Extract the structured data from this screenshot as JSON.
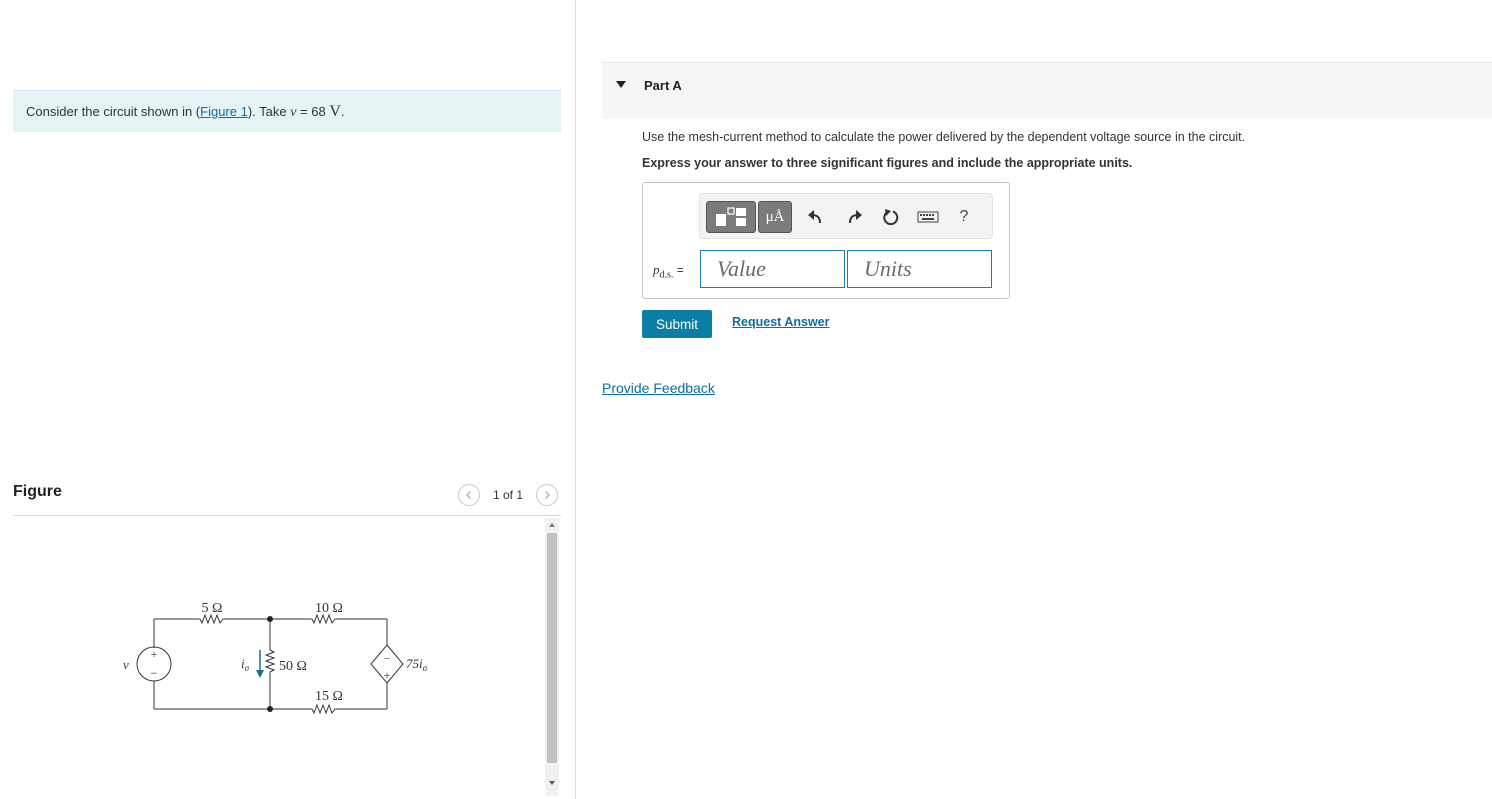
{
  "problem": {
    "prefix": "Consider the circuit shown in (",
    "figure_link": "Figure 1",
    "middle": "). Take ",
    "var": "v",
    "equals": " = 68 ",
    "unit": "V",
    "suffix": "."
  },
  "figure": {
    "title": "Figure",
    "pager": "1 of 1",
    "circuit": {
      "r1": "5 Ω",
      "r2": "10 Ω",
      "r3": "50 Ω",
      "r4": "15 Ω",
      "source_v": "v",
      "current_label": "i",
      "current_sub": "σ",
      "dep_source": "75i",
      "dep_source_sub": "σ",
      "plus": "+",
      "minus": "−"
    }
  },
  "part": {
    "title": "Part A",
    "question": "Use the mesh-current method to calculate the power delivered by the dependent voltage source in the circuit.",
    "instruction": "Express your answer to three significant figures and include the appropriate units.",
    "var_main": "p",
    "var_sub": "d.s.",
    "var_eq": " =",
    "value_placeholder": "Value",
    "units_placeholder": "Units",
    "units_button": "μÅ",
    "help_button": "?",
    "submit": "Submit",
    "request_answer": "Request Answer"
  },
  "feedback_link": "Provide Feedback",
  "icons": [
    "caret-down-icon",
    "template-icon",
    "undo-icon",
    "redo-icon",
    "reset-icon",
    "keyboard-icon",
    "chevron-left-icon",
    "chevron-right-icon"
  ]
}
